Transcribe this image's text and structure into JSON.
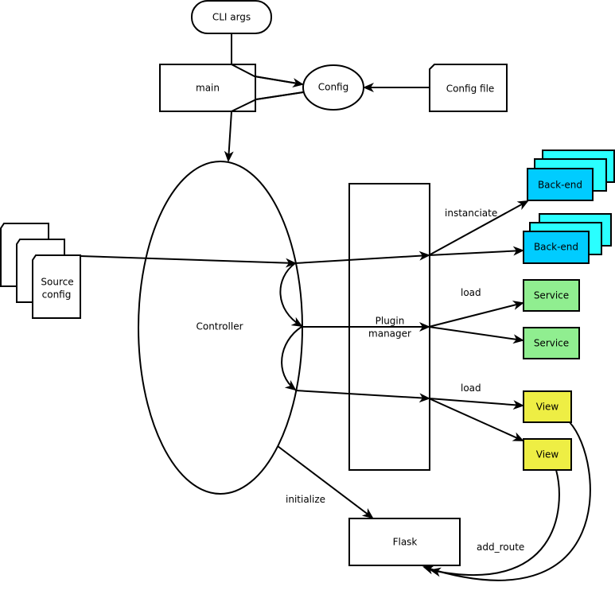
{
  "diagram": {
    "type": "architecture-flow",
    "colors": {
      "backend_front": "#00ccff",
      "backend_back": "#2affff",
      "service": "#90ee90",
      "view": "#eeee44",
      "stroke": "#000000",
      "background": "#ffffff"
    },
    "nodes": {
      "cli_args": "CLI args",
      "main": "main",
      "config": "Config",
      "config_file": "Config file",
      "source_config_line1": "Source",
      "source_config_line2": "config",
      "controller": "Controller",
      "plugin_manager_line1": "Plugin",
      "plugin_manager_line2": "manager",
      "backend_1": "Back-end",
      "backend_2": "Back-end",
      "service_1": "Service",
      "service_2": "Service",
      "view_1": "View",
      "view_2": "View",
      "flask": "Flask"
    },
    "edge_labels": {
      "instanciate": "instanciate",
      "load_services": "load",
      "load_views": "load",
      "initialize": "initialize",
      "add_route": "add_route"
    },
    "edges": [
      {
        "from": "CLI args",
        "to": "Config",
        "via": "main"
      },
      {
        "from": "main",
        "to": "Controller"
      },
      {
        "from": "Config",
        "to": "Controller",
        "via": "main"
      },
      {
        "from": "Config file",
        "to": "Config"
      },
      {
        "from": "Source config",
        "to": "Plugin manager",
        "via": "Controller"
      },
      {
        "from": "Controller",
        "to": "Plugin manager"
      },
      {
        "from": "Plugin manager",
        "to": "Back-end",
        "label": "instanciate"
      },
      {
        "from": "Plugin manager",
        "to": "Service",
        "label": "load"
      },
      {
        "from": "Plugin manager",
        "to": "View",
        "label": "load"
      },
      {
        "from": "Controller",
        "to": "Flask",
        "label": "initialize"
      },
      {
        "from": "View",
        "to": "Flask",
        "label": "add_route"
      }
    ]
  }
}
